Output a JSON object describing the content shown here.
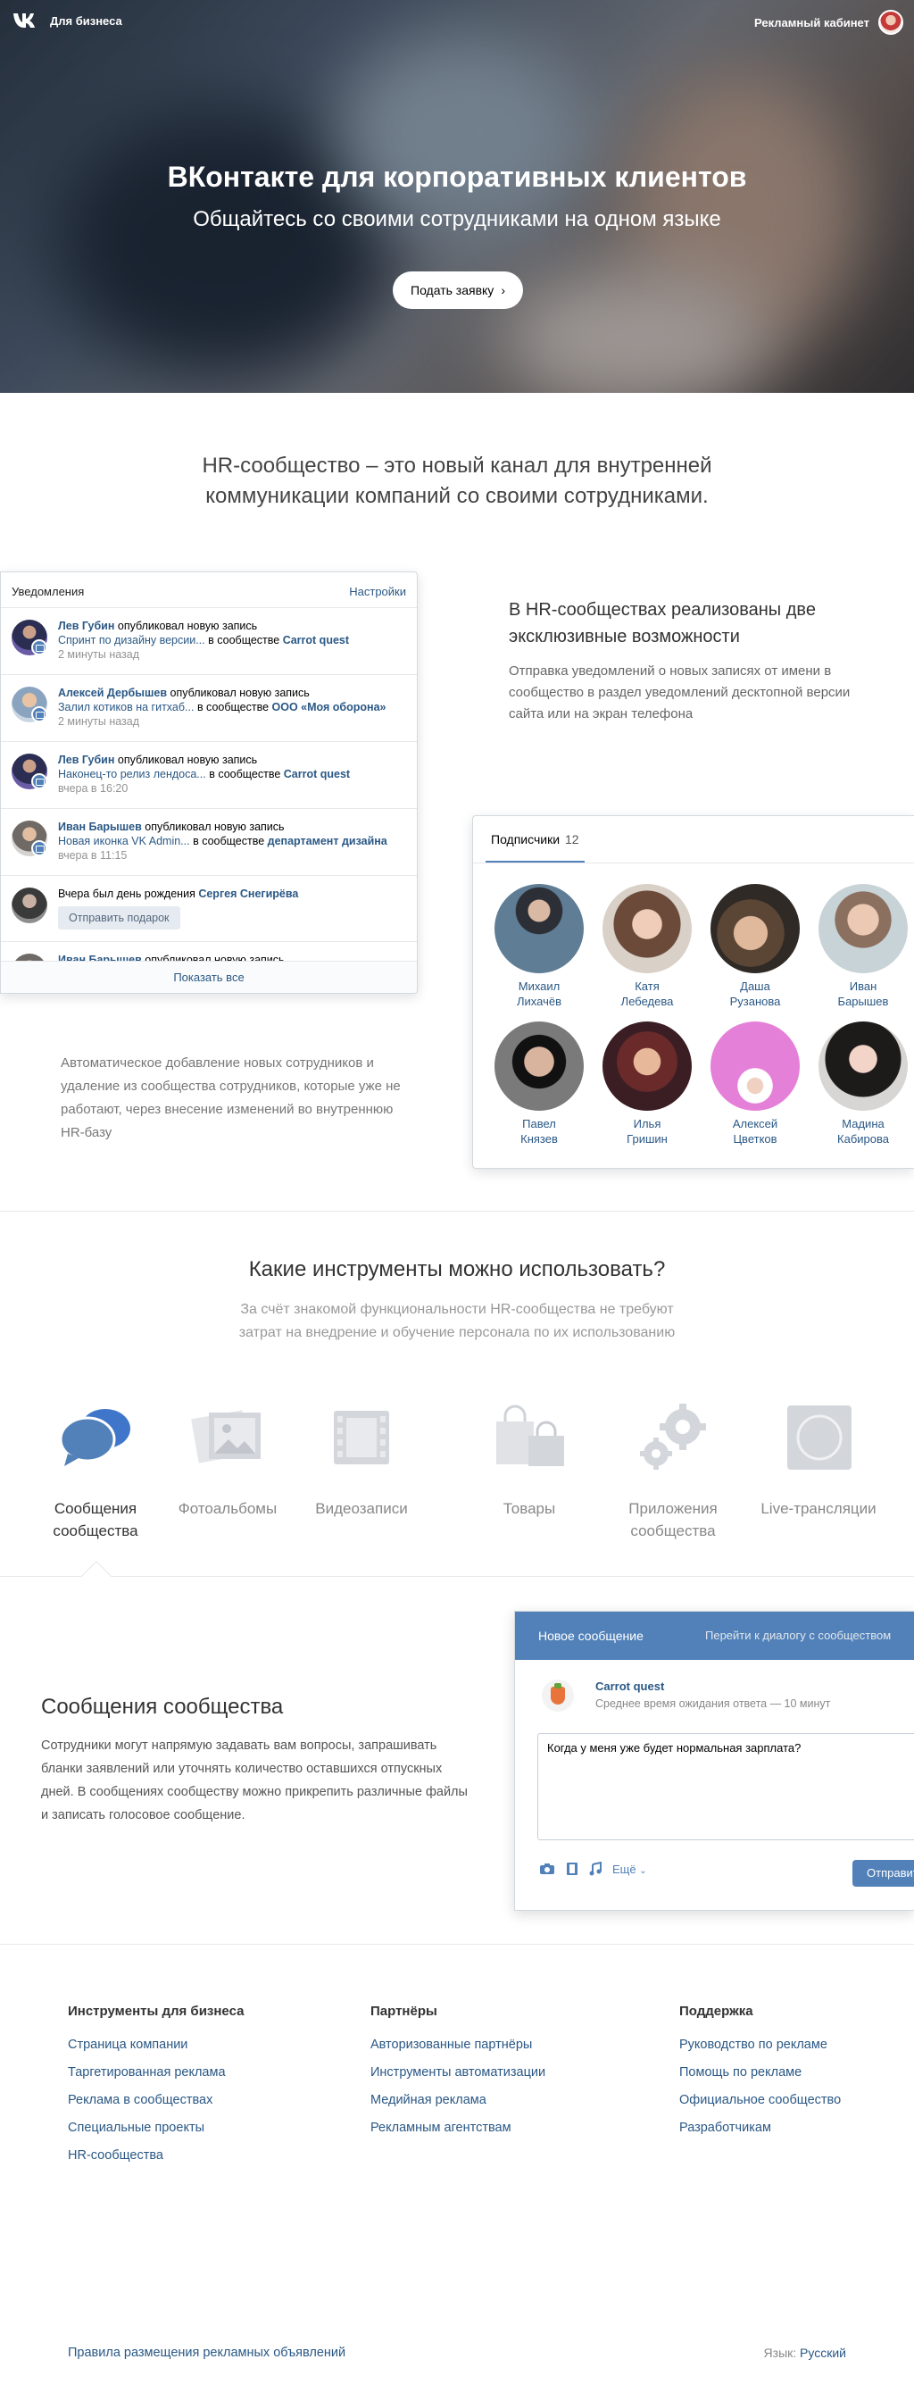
{
  "header": {
    "brand_label": "Для бизнеса",
    "ad_cabinet": "Рекламный кабинет"
  },
  "hero": {
    "title": "ВКонтакте для корпоративных клиентов",
    "subtitle": "Общайтесь со своими сотрудниками на одном языке",
    "apply_button": "Подать заявку"
  },
  "intro": {
    "line1": "HR-сообщество – это новый канал для внутренней",
    "line2": "коммуникации компаний со своими сотрудниками."
  },
  "notifications": {
    "title": "Уведомления",
    "settings": "Настройки",
    "in_community": "в сообществе",
    "published": "опубликовал новую запись",
    "items": [
      {
        "name": "Лев Губин",
        "post": "Спринт по дизайну версии...",
        "community": "Carrot quest",
        "time": "2 минуты назад"
      },
      {
        "name": "Алексей Дербышев",
        "post": "Залил котиков на гитхаб...",
        "community": "ООО «Моя оборона»",
        "time": "2 минуты назад"
      },
      {
        "name": "Лев Губин",
        "post": "Наконец-то релиз лендоса...",
        "community": "Carrot quest",
        "time": "вчера в 16:20"
      },
      {
        "name": "Иван Барышев",
        "post": "Новая иконка VK Admin...",
        "community": "департамент дизайна",
        "time": "вчера в 11:15"
      }
    ],
    "birthday_text": "Вчера был день рождения",
    "birthday_name": "Сергея Снегирёва",
    "gift_button": "Отправить подарок",
    "last_name": "Иван Барышев",
    "show_all": "Показать все"
  },
  "feature1": {
    "title_line1": "В HR-сообществах реализованы две",
    "title_line2": "эксклюзивные возможности",
    "text": "Отправка уведомлений о новых записях от имени в сообщество в раздел уведомлений десктопной версии сайта или на экран телефона"
  },
  "subscribers": {
    "tab": "Подписчики",
    "count": "12",
    "people": [
      {
        "first": "Михаил",
        "last": "Лихачёв"
      },
      {
        "first": "Катя",
        "last": "Лебедева"
      },
      {
        "first": "Даша",
        "last": "Рузанова"
      },
      {
        "first": "Иван",
        "last": "Барышев"
      },
      {
        "first": "Павел",
        "last": "Князев"
      },
      {
        "first": "Илья",
        "last": "Гришин"
      },
      {
        "first": "Алексей",
        "last": "Цветков"
      },
      {
        "first": "Мадина",
        "last": "Кабирова"
      }
    ]
  },
  "feature2": {
    "text": "Автоматическое добавление новых сотрудников и удаление из сообщества сотрудников, которые уже не работают, через внесение изменений во внутреннюю HR-базу"
  },
  "tools": {
    "heading": "Какие инструменты можно использовать?",
    "sub_line1": "За счёт знакомой функциональности HR-сообщества не требуют",
    "sub_line2": "затрат на внедрение и обучение персонала по их использованию",
    "items": [
      {
        "line1": "Сообщения",
        "line2": "сообщества",
        "icon": "messages-icon"
      },
      {
        "line1": "Фотоальбомы",
        "line2": "",
        "icon": "photo-icon"
      },
      {
        "line1": "Видеозаписи",
        "line2": "",
        "icon": "video-icon"
      },
      {
        "line1": "Товары",
        "line2": "",
        "icon": "shopping-bags-icon"
      },
      {
        "line1": "Приложения",
        "line2": "сообщества",
        "icon": "gears-icon"
      },
      {
        "line1": "Live-трансляции",
        "line2": "",
        "icon": "live-icon"
      }
    ]
  },
  "messages": {
    "heading": "Сообщения сообщества",
    "text": "Сотрудники могут напрямую задавать вам вопросы, запрашивать бланки заявлений или уточнять количество оставшихся отпускных дней. В сообщениях сообществу можно прикрепить различные файлы и записать голосовое сообщение.",
    "box_title": "Новое сообщение",
    "dialog_link": "Перейти к диалогу с сообществом",
    "community": "Carrot quest",
    "wait": "Среднее время ожидания ответа — 10 минут",
    "input_value": "Когда у меня уже будет нормальная зарплата?",
    "more": "Ещё",
    "send": "Отправить"
  },
  "footer": {
    "col1": {
      "title": "Инструменты для бизнеса",
      "links": [
        "Страница компании",
        "Таргетированная реклама",
        "Реклама в сообществах",
        "Специальные проекты",
        "HR-сообщества"
      ]
    },
    "col2": {
      "title": "Партнёры",
      "links": [
        "Авторизованные партнёры",
        "Инструменты автоматизации",
        "Медийная реклама",
        "Рекламным агентствам"
      ]
    },
    "col3": {
      "title": "Поддержка",
      "links": [
        "Руководство по рекламе",
        "Помощь по рекламе",
        "Официальное сообщество",
        "Разработчикам"
      ]
    },
    "rules": "Правила размещения рекламных объявлений",
    "lang_label": "Язык:",
    "lang_value": "Русский"
  }
}
